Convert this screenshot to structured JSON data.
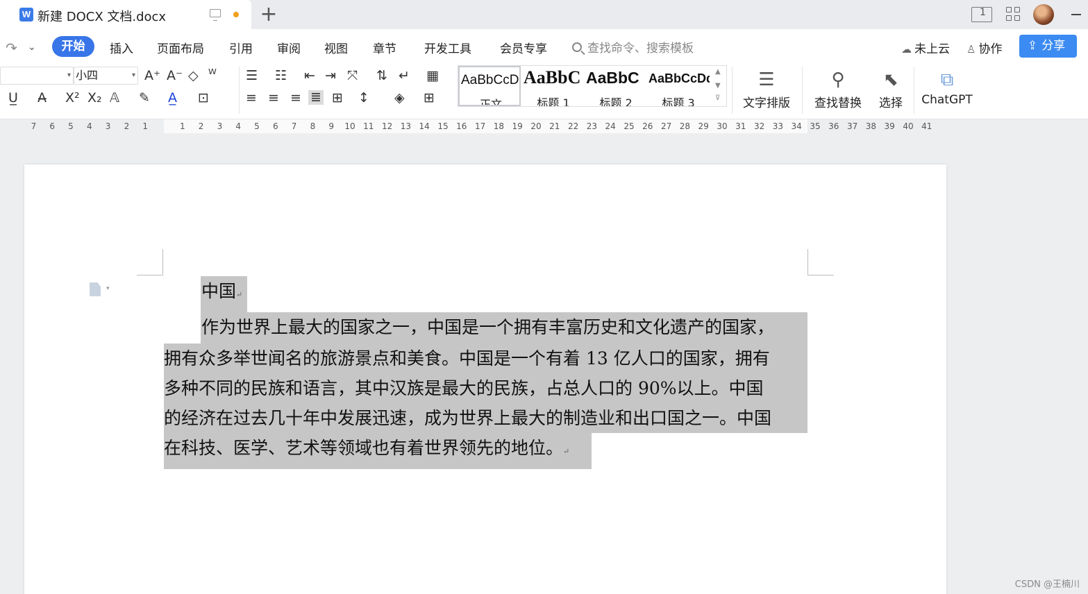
{
  "titlebar": {
    "doc_title": "新建 DOCX 文档.docx",
    "new_tab": "+",
    "layout_label": "1"
  },
  "menu": {
    "items": [
      "开始",
      "插入",
      "页面布局",
      "引用",
      "审阅",
      "视图",
      "章节",
      "开发工具",
      "会员专享"
    ],
    "search_placeholder": "查找命令、搜索模板",
    "cloud": "未上云",
    "collab": "协作",
    "share": "分享"
  },
  "ribbon": {
    "font_name": "",
    "font_size": "小四",
    "styles": [
      {
        "sample": "AaBbCcDd",
        "name": "正文"
      },
      {
        "sample": "AaBbC",
        "name": "标题 1"
      },
      {
        "sample": "AaBbC",
        "name": "标题 2"
      },
      {
        "sample": "AaBbCcDd",
        "name": "标题 3"
      }
    ],
    "tools": {
      "text_layout": "文字排版",
      "find_replace": "查找替换",
      "select": "选择",
      "chatgpt": "ChatGPT"
    }
  },
  "ruler": {
    "left_numbers": [
      "7",
      "6",
      "5",
      "4",
      "3",
      "2",
      "1"
    ],
    "right_numbers": [
      "1",
      "2",
      "3",
      "4",
      "5",
      "6",
      "7",
      "8",
      "9",
      "10",
      "11",
      "12",
      "13",
      "14",
      "15",
      "16",
      "17",
      "18",
      "19",
      "20",
      "21",
      "22",
      "23",
      "24",
      "25",
      "26",
      "27",
      "28",
      "29",
      "30",
      "31",
      "32",
      "33",
      "34",
      "35",
      "36",
      "37",
      "38",
      "39",
      "40",
      "41"
    ]
  },
  "document": {
    "heading": "中国",
    "lines": [
      "作为世界上最大的国家之一，中国是一个拥有丰富历史和文化遗产的国家，",
      "拥有众多举世闻名的旅游景点和美食。中国是一个有着 13 亿人口的国家，拥有",
      "多种不同的民族和语言，其中汉族是最大的民族，占总人口的 90%以上。中国",
      "的经济在过去几十年中发展迅速，成为世界上最大的制造业和出口国之一。中国",
      "在科技、医学、艺术等领域也有着世界领先的地位。"
    ],
    "para_mark": "↵"
  },
  "watermark": "CSDN @王楠川"
}
